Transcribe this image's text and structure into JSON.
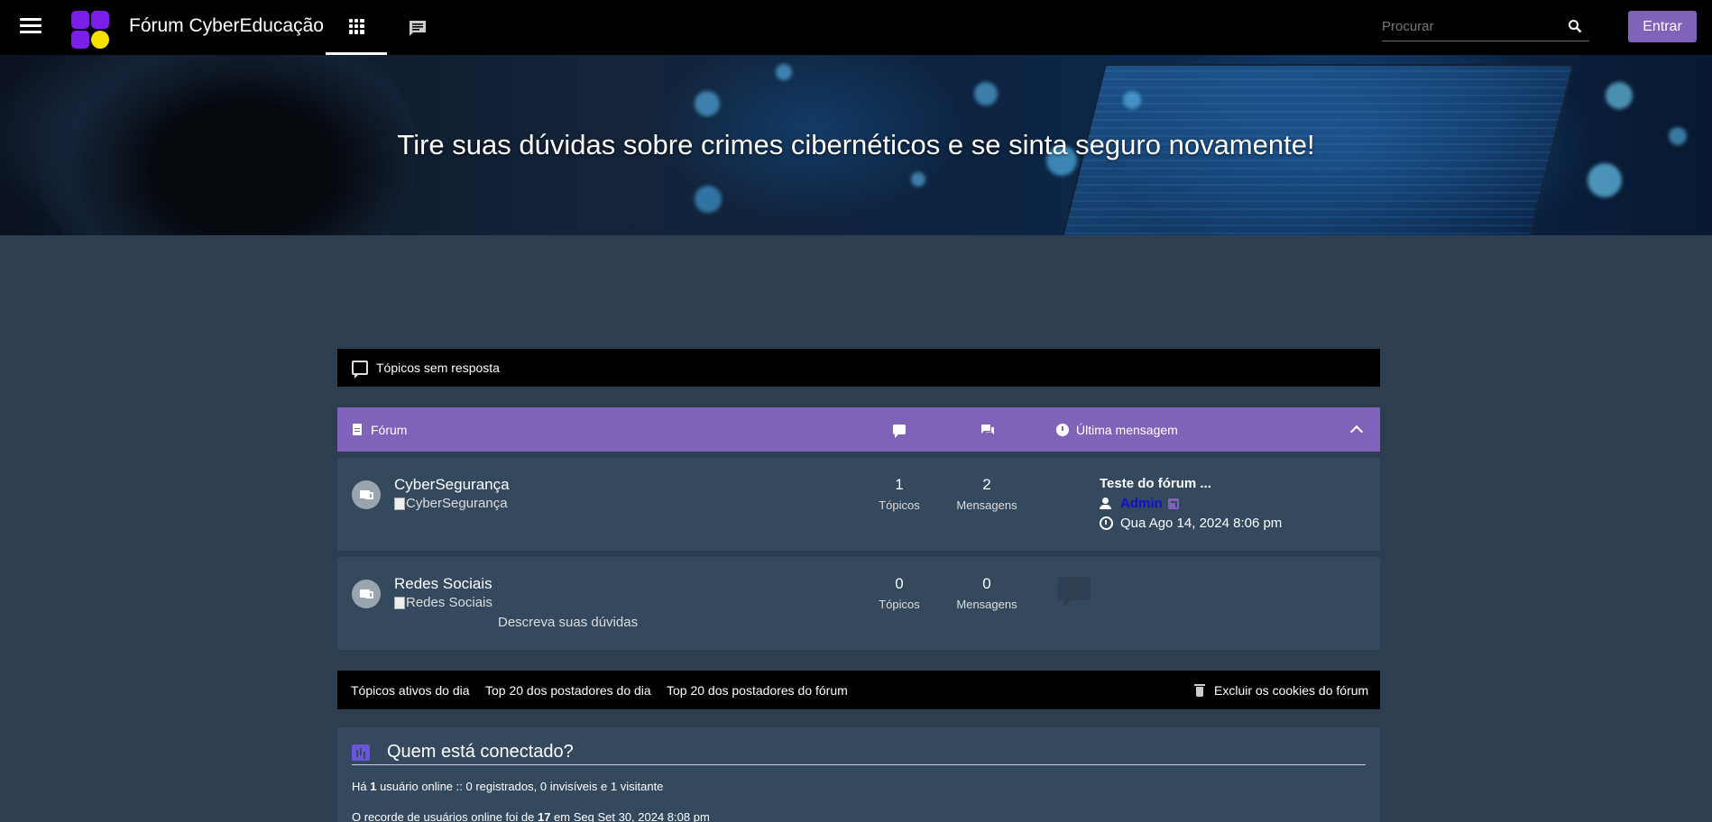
{
  "header": {
    "site_title": "Fórum CyberEducação",
    "search_placeholder": "Procurar",
    "login_label": "Entrar",
    "icons": {
      "menu": "hamburger-icon",
      "logo": "app-grid-logo",
      "apps": "grid-icon",
      "chat": "chat-icon",
      "search": "search-icon"
    }
  },
  "hero": {
    "tagline": "Tire suas dúvidas sobre crimes cibernéticos e se sinta seguro novamente!"
  },
  "unanswered": {
    "label": "Tópicos sem resposta"
  },
  "forum_table": {
    "header": {
      "forum": "Fórum",
      "last_message": "Última mensagem"
    },
    "rows": [
      {
        "name": "CyberSegurança",
        "image_alt": "CyberSegurança",
        "topics": "1",
        "topics_label": "Tópicos",
        "messages": "2",
        "messages_label": "Mensagens",
        "last_title": "Teste do fórum ...",
        "last_user": "Admin",
        "last_date": "Qua Ago 14, 2024 8:06 pm"
      },
      {
        "name": "Redes Sociais",
        "image_alt": "Redes Sociais",
        "description": "Descreva suas dúvidas",
        "topics": "0",
        "topics_label": "Tópicos",
        "messages": "0",
        "messages_label": "Mensagens"
      }
    ]
  },
  "links_bar": {
    "active_topics": "Tópicos ativos do dia",
    "top20_day": "Top 20 dos postadores do dia",
    "top20_forum": "Top 20 dos postadores do fórum",
    "delete_cookies": "Excluir os cookies do fórum"
  },
  "who_online": {
    "title": "Quem está conectado?",
    "line1_pre": "Há ",
    "line1_count": "1",
    "line1_post": " usuário online :: 0 registrados, 0 invisíveis e 1 visitante",
    "line2_pre": "O recorde de usuários online foi de ",
    "line2_count": "17",
    "line2_post": " em Seg Set 30, 2024 8:08 pm"
  },
  "colors": {
    "accent": "#7f63b8",
    "page_bg": "#2d3e50",
    "row_bg": "#34495e",
    "bar_bg": "#000000",
    "logo_purple": "#7b1fe8",
    "logo_yellow": "#f5e000"
  }
}
